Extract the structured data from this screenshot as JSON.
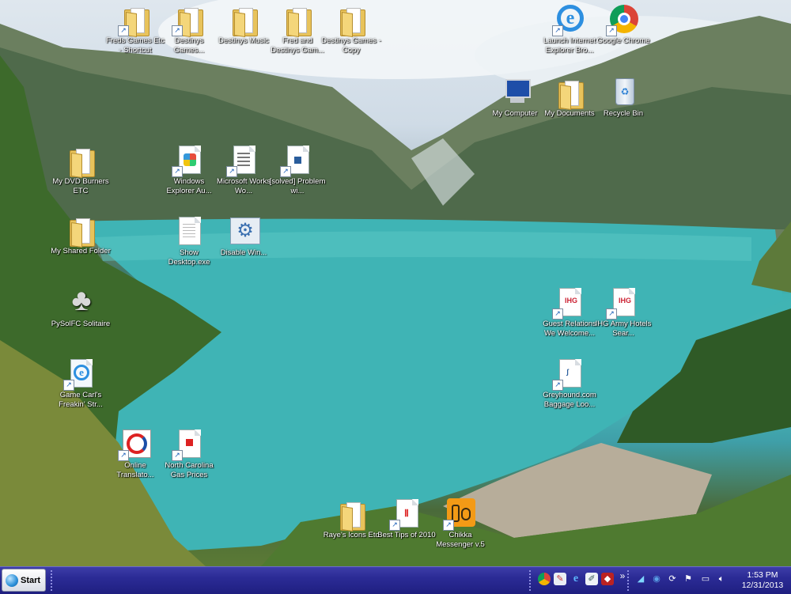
{
  "desktop": {
    "icons": [
      {
        "label": "Freds Games Etc - Shortcut",
        "type": "folder",
        "shortcut": true
      },
      {
        "label": "Destinys Games...",
        "type": "folder",
        "shortcut": true
      },
      {
        "label": "Destinys Music",
        "type": "folder",
        "shortcut": false
      },
      {
        "label": "Fred and Destinys Gam...",
        "type": "folder",
        "shortcut": false
      },
      {
        "label": "Destinys Games - Copy",
        "type": "folder",
        "shortcut": false
      },
      {
        "label": "Launch Internet Explorer Bro...",
        "type": "ie",
        "shortcut": true
      },
      {
        "label": "Google Chrome",
        "type": "chrome",
        "shortcut": true
      },
      {
        "label": "My Computer",
        "type": "computer",
        "shortcut": false
      },
      {
        "label": "My Documents",
        "type": "folder",
        "shortcut": false
      },
      {
        "label": "Recycle Bin",
        "type": "recycle",
        "shortcut": false
      },
      {
        "label": "My DVD Burners ETC",
        "type": "folder",
        "shortcut": false
      },
      {
        "label": "Windows Explorer Au...",
        "type": "windows",
        "shortcut": true
      },
      {
        "label": "Microsoft Works Wo...",
        "type": "works",
        "shortcut": true
      },
      {
        "label": "[solved] Problem wi...",
        "type": "doc",
        "shortcut": true
      },
      {
        "label": "My Shared Folder",
        "type": "folder",
        "shortcut": false
      },
      {
        "label": "Show Desktop.exe",
        "type": "doc",
        "shortcut": false
      },
      {
        "label": "Disable Win...",
        "type": "gear",
        "shortcut": false
      },
      {
        "label": "PySolFC Solitaire",
        "type": "clubs",
        "shortcut": false
      },
      {
        "label": "Guest Relations We Welcome...",
        "type": "ihg",
        "shortcut": true
      },
      {
        "label": "IHG Army Hotels Sear...",
        "type": "ihg",
        "shortcut": true
      },
      {
        "label": "Greyhound.com Baggage Loo...",
        "type": "doc",
        "shortcut": true
      },
      {
        "label": "Game Carl's Freakin' Str...",
        "type": "ie",
        "shortcut": true
      },
      {
        "label": "Online Translato...",
        "type": "translate",
        "shortcut": true
      },
      {
        "label": "North Carolina Gas Prices",
        "type": "gas",
        "shortcut": true
      },
      {
        "label": "Raye's Icons Etc",
        "type": "folder",
        "shortcut": false
      },
      {
        "label": "Best Tips of 2010",
        "type": "pdf",
        "shortcut": true
      },
      {
        "label": "Chikka Messenger v.5",
        "type": "chikka",
        "shortcut": true
      }
    ]
  },
  "taskbar": {
    "start_label": "Start",
    "clock_time": "1:53 PM",
    "clock_date": "12/31/2013",
    "overflow_label": "»"
  }
}
